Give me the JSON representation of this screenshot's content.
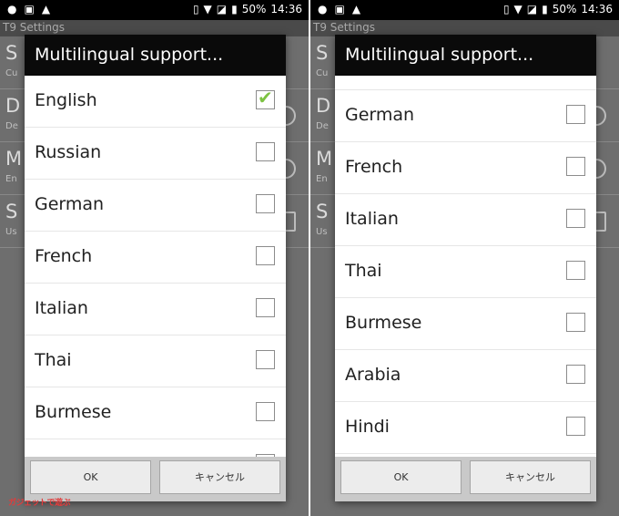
{
  "status_bar": {
    "battery": "50%",
    "time": "14:36",
    "left_icons": [
      "android-icon",
      "image-icon",
      "warning-icon"
    ],
    "right_icons": [
      "vibrate-icon",
      "wifi-icon",
      "no-sim-icon",
      "battery-icon"
    ]
  },
  "app": {
    "title": "T9 Settings"
  },
  "background_items": [
    {
      "letter": "S",
      "sub": "Cu"
    },
    {
      "letter": "D",
      "sub": "De"
    },
    {
      "letter": "M",
      "sub": "En"
    },
    {
      "letter": "S",
      "sub": "Us"
    }
  ],
  "dialog": {
    "title": "Multilingual support...",
    "ok_label": "OK",
    "cancel_label": "キャンセル"
  },
  "left_options": [
    {
      "label": "English",
      "checked": true
    },
    {
      "label": "Russian",
      "checked": false
    },
    {
      "label": "German",
      "checked": false
    },
    {
      "label": "French",
      "checked": false
    },
    {
      "label": "Italian",
      "checked": false
    },
    {
      "label": "Thai",
      "checked": false
    },
    {
      "label": "Burmese",
      "checked": false
    }
  ],
  "right_options": [
    {
      "label": "German",
      "checked": false
    },
    {
      "label": "French",
      "checked": false
    },
    {
      "label": "Italian",
      "checked": false
    },
    {
      "label": "Thai",
      "checked": false
    },
    {
      "label": "Burmese",
      "checked": false
    },
    {
      "label": "Arabia",
      "checked": false
    },
    {
      "label": "Hindi",
      "checked": false
    }
  ],
  "watermark": "ガジェットで遊ぶ",
  "colors": {
    "check": "#7cc242",
    "title_bar": "#0a0a0a",
    "button_bar": "#c9c9c9"
  }
}
